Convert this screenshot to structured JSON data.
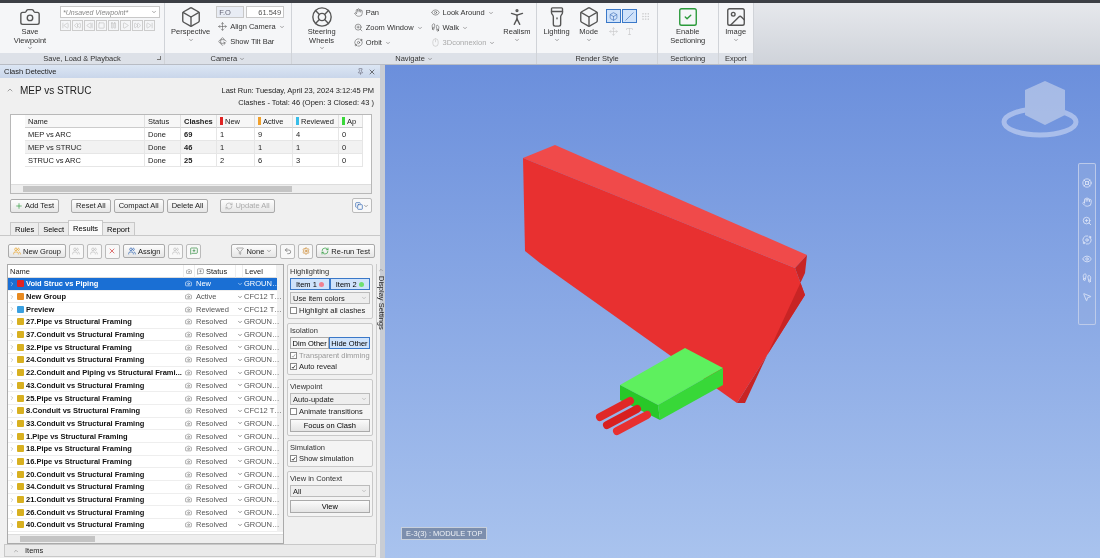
{
  "ribbon": {
    "groups": [
      {
        "label": "Save, Load & Playback",
        "launcher": true,
        "items": [
          {
            "kind": "large",
            "label": "Save Viewpoint",
            "dropdown": true
          },
          {
            "kind": "column",
            "items": [
              {
                "kind": "combo",
                "placeholder": "*Unsaved Viewpoint*"
              },
              {
                "kind": "playback"
              }
            ]
          }
        ]
      },
      {
        "label": "Camera",
        "dropdown": true,
        "items": [
          {
            "kind": "large",
            "label": "Perspective",
            "dropdown": true
          },
          {
            "kind": "column",
            "items": [
              {
                "kind": "field",
                "label": "F.O",
                "value": "61.549"
              },
              {
                "kind": "button",
                "label": "Align Camera",
                "dropdown": true
              },
              {
                "kind": "button",
                "label": "Show Tilt Bar",
                "dropdown": false
              }
            ]
          }
        ]
      },
      {
        "label": "Navigate",
        "dropdown": true,
        "items": [
          {
            "kind": "large",
            "label": "Steering Wheels",
            "dropdown": true
          },
          {
            "kind": "column",
            "items": [
              {
                "kind": "button",
                "label": "Pan",
                "dropdown": false
              },
              {
                "kind": "button",
                "label": "Zoom Window",
                "dropdown": true
              },
              {
                "kind": "button",
                "label": "Orbit",
                "dropdown": true
              }
            ]
          },
          {
            "kind": "column",
            "items": [
              {
                "kind": "button",
                "label": "Look Around",
                "dropdown": true
              },
              {
                "kind": "button",
                "label": "Walk",
                "dropdown": true
              },
              {
                "kind": "button",
                "label": "3Dconnexion",
                "dropdown": true,
                "disabled": true
              }
            ]
          },
          {
            "kind": "large",
            "label": "Realism",
            "dropdown": true
          }
        ]
      },
      {
        "label": "Render Style",
        "items": [
          {
            "kind": "large",
            "label": "Lighting",
            "dropdown": true
          },
          {
            "kind": "large",
            "label": "Mode",
            "dropdown": true
          },
          {
            "kind": "toggles",
            "items": [
              {
                "selected": true
              },
              {
                "selected": true
              },
              {
                "selected": false
              },
              {
                "selected": false
              },
              {
                "selected": false
              }
            ]
          }
        ]
      },
      {
        "label": "Sectioning",
        "items": [
          {
            "kind": "large",
            "label": "Enable Sectioning",
            "dropdown": false
          }
        ]
      },
      {
        "label": "Export",
        "items": [
          {
            "kind": "large",
            "label": "Image",
            "dropdown": true
          }
        ]
      }
    ]
  },
  "clash_detective": {
    "title": "Clash Detective",
    "test_name": "MEP vs STRUC",
    "last_run": "Last Run:  Tuesday, April 23, 2024 3:12:45 PM",
    "summary": "Clashes -  Total:  46  (Open:  3  Closed:  43 )",
    "tests_table": {
      "columns": [
        {
          "label": "Name"
        },
        {
          "label": "Status"
        },
        {
          "label": "Clashes"
        },
        {
          "label": "New",
          "color": "#e02424"
        },
        {
          "label": "Active",
          "color": "#f0a02c"
        },
        {
          "label": "Reviewed",
          "color": "#38bde8"
        },
        {
          "label": "Ap",
          "color": "#3ad83a"
        }
      ],
      "rows": [
        [
          "MEP vs ARC",
          "Done",
          "69",
          "1",
          "9",
          "4",
          "0"
        ],
        [
          "MEP vs STRUC",
          "Done",
          "46",
          "1",
          "1",
          "1",
          "0"
        ],
        [
          "STRUC vs ARC",
          "Done",
          "25",
          "2",
          "6",
          "3",
          "0"
        ]
      ]
    },
    "test_buttons": [
      {
        "label": "Add Test",
        "disabled": false
      },
      {
        "label": "Reset All",
        "disabled": false
      },
      {
        "label": "Compact All",
        "disabled": false
      },
      {
        "label": "Delete All",
        "disabled": false
      },
      {
        "label": "Update All",
        "disabled": true
      }
    ],
    "tabs": [
      {
        "label": "Rules",
        "selected": false
      },
      {
        "label": "Select",
        "selected": false
      },
      {
        "label": "Results",
        "selected": true
      },
      {
        "label": "Report",
        "selected": false
      }
    ],
    "results_toolbar": {
      "new_group": "New Group",
      "assign": "Assign",
      "filter": "None",
      "rerun": "Re-run Test"
    },
    "results": {
      "columns": [
        "Name",
        "Status",
        "Level"
      ],
      "rows": [
        {
          "name": "Void Struc vs Piping",
          "status": "New",
          "color": "#e02424",
          "level": "GROUN…",
          "selected": true
        },
        {
          "name": "New Group",
          "status": "Active",
          "color": "#e88a20",
          "level": "CFC12 T…",
          "selected": false
        },
        {
          "name": "Preview",
          "status": "Reviewed",
          "color": "#3aa0e0",
          "level": "CFC12 T…",
          "selected": false
        },
        {
          "name": "27.Pipe vs Structural Framing",
          "status": "Resolved",
          "color": "#d8b020",
          "level": "GROUN…",
          "selected": false
        },
        {
          "name": "37.Conduit vs Structural Framing",
          "status": "Resolved",
          "color": "#d8b020",
          "level": "GROUN…",
          "selected": false
        },
        {
          "name": "32.Pipe vs Structural Framing",
          "status": "Resolved",
          "color": "#d8b020",
          "level": "GROUN…",
          "selected": false
        },
        {
          "name": "24.Conduit vs Structural Framing",
          "status": "Resolved",
          "color": "#d8b020",
          "level": "GROUN…",
          "selected": false
        },
        {
          "name": "22.Conduit and Piping vs Structural Frami...",
          "status": "Resolved",
          "color": "#d8b020",
          "level": "GROUN…",
          "selected": false
        },
        {
          "name": "43.Conduit vs Structural Framing",
          "status": "Resolved",
          "color": "#d8b020",
          "level": "GROUN…",
          "selected": false
        },
        {
          "name": "25.Pipe vs Structural Framing",
          "status": "Resolved",
          "color": "#d8b020",
          "level": "GROUN…",
          "selected": false
        },
        {
          "name": "8.Conduit vs Structural Framing",
          "status": "Resolved",
          "color": "#d8b020",
          "level": "CFC12 T…",
          "selected": false
        },
        {
          "name": "33.Conduit vs Structural Framing",
          "status": "Resolved",
          "color": "#d8b020",
          "level": "GROUN…",
          "selected": false
        },
        {
          "name": "1.Pipe vs Structural Framing",
          "status": "Resolved",
          "color": "#d8b020",
          "level": "GROUN…",
          "selected": false
        },
        {
          "name": "18.Pipe vs Structural Framing",
          "status": "Resolved",
          "color": "#d8b020",
          "level": "GROUN…",
          "selected": false
        },
        {
          "name": "16.Pipe vs Structural Framing",
          "status": "Resolved",
          "color": "#d8b020",
          "level": "GROUN…",
          "selected": false
        },
        {
          "name": "20.Conduit vs Structural Framing",
          "status": "Resolved",
          "color": "#d8b020",
          "level": "GROUN…",
          "selected": false
        },
        {
          "name": "34.Conduit vs Structural Framing",
          "status": "Resolved",
          "color": "#d8b020",
          "level": "GROUN…",
          "selected": false
        },
        {
          "name": "21.Conduit vs Structural Framing",
          "status": "Resolved",
          "color": "#d8b020",
          "level": "GROUN…",
          "selected": false
        },
        {
          "name": "26.Conduit vs Structural Framing",
          "status": "Resolved",
          "color": "#d8b020",
          "level": "GROUN…",
          "selected": false
        },
        {
          "name": "40.Conduit vs Structural Framing",
          "status": "Resolved",
          "color": "#d8b020",
          "level": "GROUN…",
          "selected": false
        }
      ]
    },
    "display_settings": {
      "tab_label": "Display Settings",
      "highlighting": {
        "title": "Highlighting",
        "items": [
          {
            "label": "Item 1",
            "color": "#f08090",
            "selected": true
          },
          {
            "label": "Item 2",
            "color": "#70e070",
            "selected": true
          }
        ],
        "select": "Use item colors",
        "highlight_all": {
          "label": "Highlight all clashes",
          "checked": false
        }
      },
      "isolation": {
        "title": "Isolation",
        "modes": [
          {
            "label": "Dim Other",
            "selected": false
          },
          {
            "label": "Hide Other",
            "selected": true
          }
        ],
        "checks": [
          {
            "label": "Transparent dimming",
            "checked": true,
            "disabled": true
          },
          {
            "label": "Auto reveal",
            "checked": true,
            "disabled": false
          }
        ]
      },
      "viewpoint": {
        "title": "Viewpoint",
        "select": "Auto-update",
        "animate": {
          "label": "Animate transitions",
          "checked": false
        },
        "button": "Focus on Clash"
      },
      "simulation": {
        "title": "Simulation",
        "show": {
          "label": "Show simulation",
          "checked": true
        }
      },
      "view_in_context": {
        "title": "View in Context",
        "select": "All",
        "button": "View"
      }
    },
    "items_bar": "Items"
  },
  "viewport": {
    "label": "E-3(3) : MODULE TOP"
  }
}
